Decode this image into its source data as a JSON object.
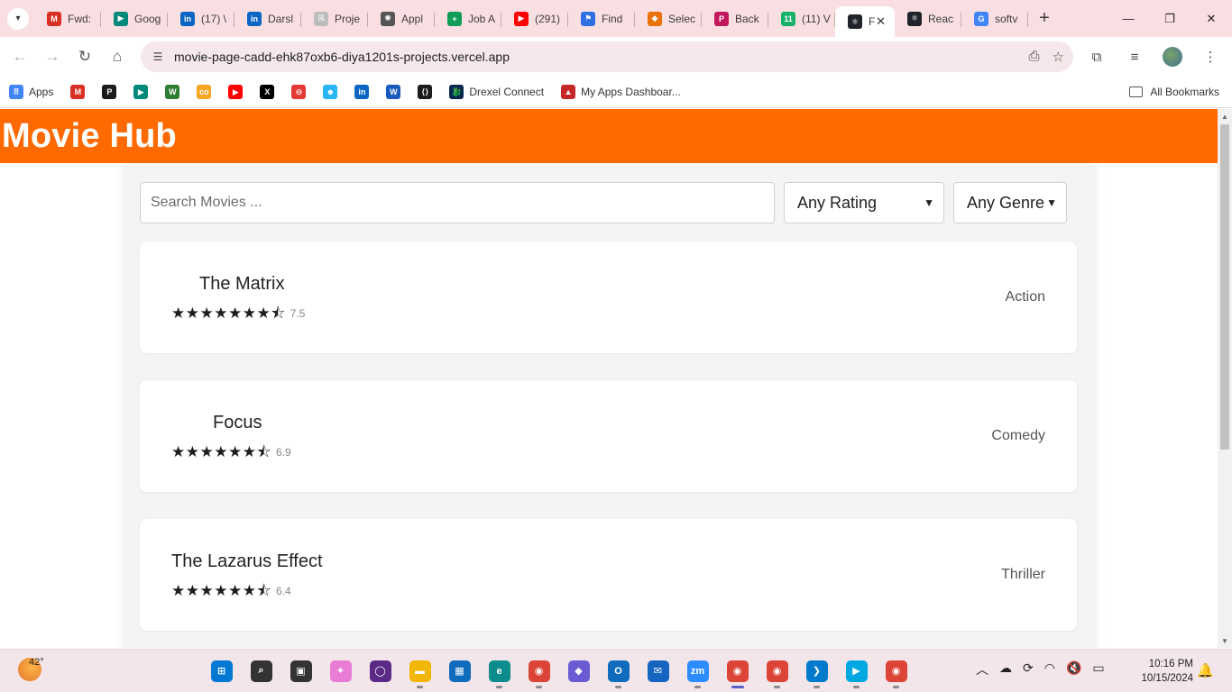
{
  "browser": {
    "tabs": [
      {
        "title": "Fwd:",
        "icon": "gmail-icon",
        "color": "#d93025",
        "glyph": "M"
      },
      {
        "title": "Goog",
        "icon": "meet-icon",
        "color": "#00897b",
        "glyph": "▶"
      },
      {
        "title": "(17) \\",
        "icon": "linkedin-icon",
        "color": "#0a66c2",
        "glyph": "in"
      },
      {
        "title": "Darsl",
        "icon": "linkedin-icon",
        "color": "#0a66c2",
        "glyph": "in"
      },
      {
        "title": "Proje",
        "icon": "page-icon",
        "color": "#bdbdbd",
        "glyph": "ℝ"
      },
      {
        "title": "Appl",
        "icon": "openai-icon",
        "color": "#555555",
        "glyph": "✺"
      },
      {
        "title": "Job A",
        "icon": "sheets-icon",
        "color": "#0f9d58",
        "glyph": "+"
      },
      {
        "title": "(291)",
        "icon": "youtube-icon",
        "color": "#ff0000",
        "glyph": "▶"
      },
      {
        "title": "Find",
        "icon": "flag-icon",
        "color": "#2f6fe4",
        "glyph": "⚑"
      },
      {
        "title": "Selec",
        "icon": "puzzle-icon",
        "color": "#e8710a",
        "glyph": "◆"
      },
      {
        "title": "Back",
        "icon": "p-icon",
        "color": "#c2185b",
        "glyph": "P"
      },
      {
        "title": "(11) V",
        "icon": "counter-icon",
        "color": "#17b26a",
        "glyph": "11"
      },
      {
        "title": "F",
        "icon": "react-icon",
        "color": "#20232a",
        "glyph": "⚛",
        "active": true
      },
      {
        "title": "Reac",
        "icon": "react-icon",
        "color": "#20232a",
        "glyph": "⚛"
      },
      {
        "title": "softv",
        "icon": "google-icon",
        "color": "#4285f4",
        "glyph": "G"
      }
    ],
    "url": "movie-page-cadd-ehk87oxb6-diya1201s-projects.vercel.app",
    "bookmarks": [
      {
        "label": "Apps",
        "icon": "apps-grid-icon",
        "color": "#4285f4",
        "glyph": "⠿"
      },
      {
        "label": "",
        "icon": "gmail-icon",
        "color": "#d93025",
        "glyph": "M"
      },
      {
        "label": "",
        "icon": "p-icon",
        "color": "#1b1b1b",
        "glyph": "P"
      },
      {
        "label": "",
        "icon": "meet-icon",
        "color": "#00897b",
        "glyph": "▶"
      },
      {
        "label": "",
        "icon": "w-icon",
        "color": "#2e7d32",
        "glyph": "W"
      },
      {
        "label": "",
        "icon": "co-icon",
        "color": "#f5a623",
        "glyph": "co"
      },
      {
        "label": "",
        "icon": "youtube-icon",
        "color": "#ff0000",
        "glyph": "▶"
      },
      {
        "label": "",
        "icon": "x-icon",
        "color": "#000000",
        "glyph": "X"
      },
      {
        "label": "",
        "icon": "circle-icon",
        "color": "#e53935",
        "glyph": "⊖"
      },
      {
        "label": "",
        "icon": "mascot-icon",
        "color": "#29b6f6",
        "glyph": "☻"
      },
      {
        "label": "",
        "icon": "linkedin-icon",
        "color": "#0a66c2",
        "glyph": "in"
      },
      {
        "label": "",
        "icon": "word-icon",
        "color": "#185abd",
        "glyph": "W"
      },
      {
        "label": "",
        "icon": "code-icon",
        "color": "#1b1b1b",
        "glyph": "⟨⟩"
      },
      {
        "label": "Drexel Connect",
        "icon": "dragon-icon",
        "color": "#07294d",
        "glyph": "🐉"
      },
      {
        "label": "My Apps Dashboar...",
        "icon": "dashboard-icon",
        "color": "#c62828",
        "glyph": "▲"
      }
    ],
    "all_bookmarks": "All Bookmarks"
  },
  "app": {
    "title": "Movie Hub",
    "search_placeholder": "Search Movies ...",
    "rating_filter": "Any Rating",
    "genre_filter": "Any Genre",
    "accent": "#ff6a00"
  },
  "movies": [
    {
      "title": "The Matrix",
      "rating": "7.5",
      "stars": "★★★★★★★⯪",
      "genre": "Action"
    },
    {
      "title": "Focus",
      "rating": "6.9",
      "stars": "★★★★★★⯪",
      "genre": "Comedy"
    },
    {
      "title": "The Lazarus Effect",
      "rating": "6.4",
      "stars": "★★★★★★⯪",
      "genre": "Thriller"
    }
  ],
  "taskbar": {
    "temperature": "42°",
    "time": "10:16 PM",
    "date": "10/15/2024",
    "apps": [
      {
        "name": "start-icon",
        "color": "#0078d4",
        "glyph": "⊞"
      },
      {
        "name": "search-icon",
        "color": "#333333",
        "glyph": "⌕"
      },
      {
        "name": "task-view-icon",
        "color": "#333333",
        "glyph": "▣"
      },
      {
        "name": "copilot-icon",
        "color": "#e97cd5",
        "glyph": "✦"
      },
      {
        "name": "alexa-icon",
        "color": "#5b2a86",
        "glyph": "◯"
      },
      {
        "name": "file-explorer-icon",
        "color": "#f2b705",
        "glyph": "▬"
      },
      {
        "name": "store-icon",
        "color": "#0f6cbd",
        "glyph": "▦"
      },
      {
        "name": "edge-icon",
        "color": "#0c8c8c",
        "glyph": "e"
      },
      {
        "name": "chrome-icon",
        "color": "#db4437",
        "glyph": "◉"
      },
      {
        "name": "photos-icon",
        "color": "#6b5bd2",
        "glyph": "◆"
      },
      {
        "name": "outlook-icon",
        "color": "#0f6cbd",
        "glyph": "O"
      },
      {
        "name": "mail-icon",
        "color": "#1565c0",
        "glyph": "✉"
      },
      {
        "name": "zoom-icon",
        "color": "#2d8cff",
        "glyph": "zm"
      },
      {
        "name": "chrome-icon",
        "color": "#db4437",
        "glyph": "◉"
      },
      {
        "name": "chrome-icon",
        "color": "#db4437",
        "glyph": "◉"
      },
      {
        "name": "vscode-icon",
        "color": "#007acc",
        "glyph": "❯"
      },
      {
        "name": "prime-video-icon",
        "color": "#00a8e1",
        "glyph": "▶"
      },
      {
        "name": "chrome-icon",
        "color": "#db4437",
        "glyph": "◉"
      }
    ]
  }
}
